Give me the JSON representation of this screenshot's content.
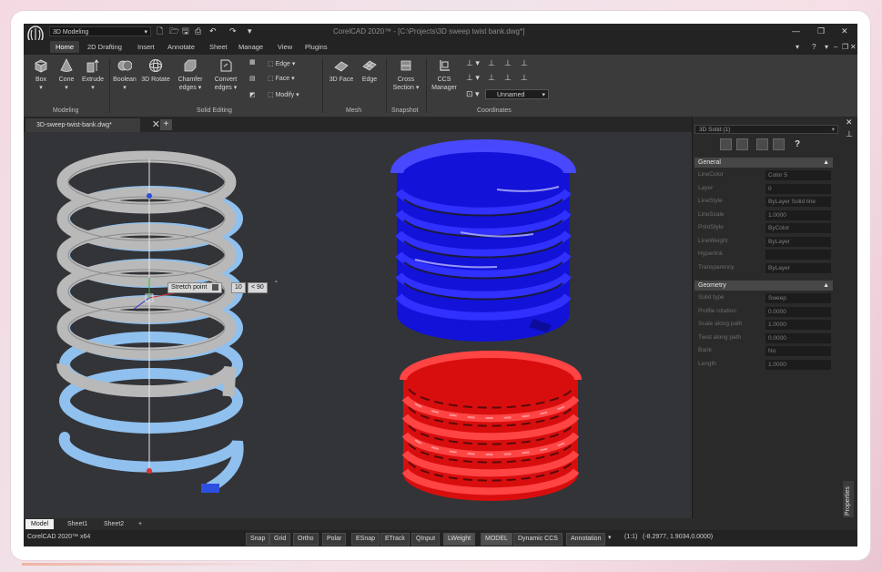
{
  "app": {
    "workspace": "3D Modeling",
    "window_title": "CorelCAD 2020™ - [C:\\Projects\\3D sweep twist bank.dwg*]"
  },
  "ribbon_tabs": [
    "Home",
    "2D Drafting",
    "Insert",
    "Annotate",
    "Sheet",
    "Manage",
    "View",
    "Plugins"
  ],
  "ribbon": {
    "modeling": {
      "group": "Modeling",
      "tools": [
        "Box",
        "Cone",
        "Extrude"
      ]
    },
    "solid_editing": {
      "group": "Solid Editing",
      "tools": [
        "Boolean",
        "3D Rotate",
        "Chamfer edges",
        "Convert edges"
      ],
      "small": [
        "Edge",
        "Face",
        "Modify"
      ]
    },
    "mesh": {
      "group": "Mesh",
      "tools": [
        "3D Face",
        "Edge"
      ]
    },
    "snapshot": {
      "group": "Snapshot",
      "tools": [
        "Cross Section"
      ]
    },
    "coordinates": {
      "group": "Coordinates",
      "tools": [
        "CCS Manager"
      ],
      "ccs_value": "Unnamed"
    }
  },
  "document_tab": "3D-sweep-twist-bank.dwg*",
  "viewport": {
    "stretch_label": "Stretch point",
    "input_a": "10",
    "input_b": "< 90",
    "degree": "°"
  },
  "properties": {
    "selection": "3D Solid (1)",
    "sections": [
      {
        "title": "General",
        "rows": [
          {
            "label": "LineColor",
            "value": "Color 5"
          },
          {
            "label": "Layer",
            "value": "0"
          },
          {
            "label": "LineStyle",
            "value": "ByLayer  Solid line"
          },
          {
            "label": "LineScale",
            "value": "1.0000"
          },
          {
            "label": "PrintStyle",
            "value": "ByColor"
          },
          {
            "label": "LineWeight",
            "value": "ByLayer"
          },
          {
            "label": "Hyperlink",
            "value": ""
          },
          {
            "label": "Transparency",
            "value": "ByLayer"
          }
        ]
      },
      {
        "title": "Geometry",
        "rows": [
          {
            "label": "Solid type",
            "value": "Sweep"
          },
          {
            "label": "Profile rotation",
            "value": "0.0000"
          },
          {
            "label": "Scale along path",
            "value": "1.0000"
          },
          {
            "label": "Twist along path",
            "value": "0.0000"
          },
          {
            "label": "Bank",
            "value": "No"
          },
          {
            "label": "Length",
            "value": "1.0000"
          }
        ]
      }
    ],
    "side_label": "Properties"
  },
  "layout_tabs": [
    "Model",
    "Sheet1",
    "Sheet2"
  ],
  "layout_add": "+",
  "status": {
    "left": "CorelCAD 2020™ x64",
    "buttons": [
      "Snap",
      "Grid",
      "Ortho",
      "Polar",
      "ESnap",
      "ETrack",
      "QInput",
      "LWeight",
      "MODEL",
      "Dynamic CCS",
      "Annotation"
    ],
    "scale": "(1:1)",
    "coords": "(-8.2977, 1.9034,0.0000)"
  },
  "colors": {
    "blue_coil": "#1616e6",
    "red_coil": "#e61010",
    "gray_coil": "#b9b9b9",
    "light_blue_coil": "#8fc0ee"
  }
}
